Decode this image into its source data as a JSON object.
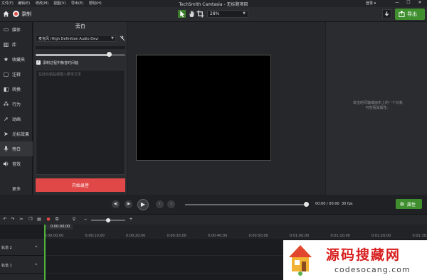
{
  "menubar": {
    "items": [
      "文件(F)",
      "编辑(E)",
      "修改(M)",
      "视图(V)",
      "导出(E)",
      "帮助(H)"
    ],
    "title": "TechSmith Camtasia - 无标题项目",
    "login": "登录 ▾",
    "controls": [
      "—",
      "☐",
      "✕"
    ]
  },
  "toolbar": {
    "record_label": "录制",
    "zoom_value": "28%",
    "export_label": "导出"
  },
  "sidebar": {
    "items": [
      {
        "label": "媒体",
        "icon": "media-icon"
      },
      {
        "label": "库",
        "icon": "library-icon"
      },
      {
        "label": "收藏夹",
        "icon": "star-icon"
      },
      {
        "label": "注释",
        "icon": "annotation-icon"
      },
      {
        "label": "转换",
        "icon": "transition-icon"
      },
      {
        "label": "行为",
        "icon": "behavior-icon"
      },
      {
        "label": "动画",
        "icon": "animation-icon"
      },
      {
        "label": "光标效果",
        "icon": "cursor-icon"
      },
      {
        "label": "旁白",
        "icon": "mic-icon",
        "active": true
      },
      {
        "label": "音效",
        "icon": "speaker-icon"
      }
    ],
    "more_label": "更多"
  },
  "narration": {
    "title": "旁白",
    "mic_device": "麦克风 (High Definition Audio Devi",
    "gain_level": 0.82,
    "mute_label": "录制过程中静音时间轴",
    "mute_checked": true,
    "script_placeholder": "在此处粘贴或键入脚本文本",
    "start_label": "开始录音"
  },
  "properties": {
    "hint": "单击时间轴或画布上的一个对象\n可查看其属性。",
    "button_label": "属性"
  },
  "playback": {
    "time": "00:00 / 00:00",
    "fps": "30 fps",
    "position": 1.0
  },
  "timeline": {
    "playhead_time": "0:00:00;00",
    "ticks": [
      "0:00:00;00",
      "0:00:10;00",
      "0:00:20;00",
      "0:00:30;00",
      "0:00:40;00",
      "0:00:50;00",
      "0:01:00;00",
      "0:01:10;00",
      "0:01:20;00",
      "0:01:30;00"
    ],
    "tracks": [
      "轨道 2",
      "轨道 1"
    ]
  },
  "watermark": {
    "title": "源码搜藏网",
    "url": "codesocang.com"
  },
  "colors": {
    "accent_green": "#3f8f2e",
    "record_red": "#e04848"
  }
}
